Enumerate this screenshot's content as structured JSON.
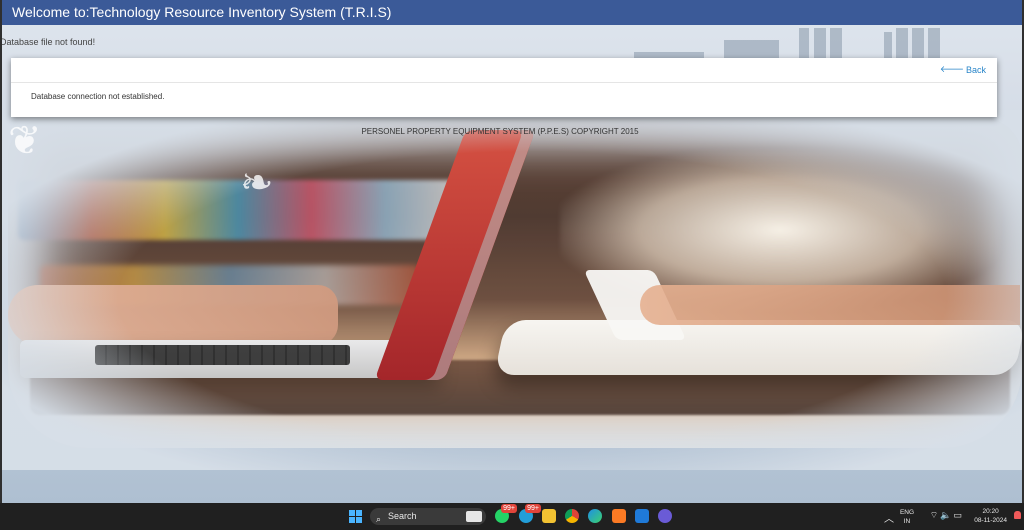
{
  "window": {
    "title": "Welcome to:Technology Resource Inventory System (T.R.I.S)"
  },
  "messages": {
    "top_error": "Database file not found!",
    "panel_back": "Back",
    "panel_message": "Database connection not established.",
    "copyright": "PERSONEL PROPERTY EQUIPMENT SYSTEM (P.P.E.S) COPYRIGHT 2015"
  },
  "taskbar": {
    "search_label": "Search",
    "badges": {
      "whatsapp": "99+",
      "telegram": "99+"
    },
    "language_line1": "ENG",
    "language_line2": "IN",
    "time": "20:20",
    "date": "08-11-2024",
    "icons": [
      "windows-icon",
      "search-icon",
      "whatsapp-icon",
      "telegram-icon",
      "files-icon",
      "chrome-icon",
      "edge-icon",
      "xampp-icon",
      "vscode-icon",
      "app-icon",
      "chevron-up-icon",
      "wifi-icon",
      "volume-icon",
      "battery-icon",
      "notification-icon"
    ]
  },
  "colors": {
    "titlebar": "#3b5a98",
    "link": "#2a86c9",
    "taskbar": "#202020"
  }
}
